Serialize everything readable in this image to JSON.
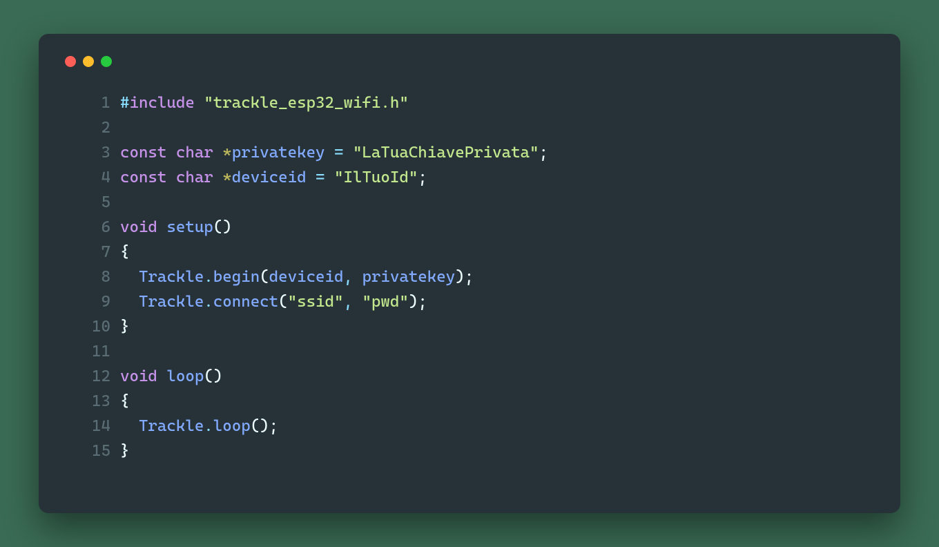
{
  "window": {
    "dots": [
      "red",
      "yellow",
      "green"
    ]
  },
  "code": {
    "line_numbers": [
      "1",
      "2",
      "3",
      "4",
      "5",
      "6",
      "7",
      "8",
      "9",
      "10",
      "11",
      "12",
      "13",
      "14",
      "15"
    ],
    "lines": [
      {
        "tokens": [
          {
            "cls": "t-operator",
            "text": "#"
          },
          {
            "cls": "t-builtin",
            "text": "include"
          },
          {
            "cls": "t-ident",
            "text": " "
          },
          {
            "cls": "t-string",
            "text": "\"trackle_esp32_wifi.h\""
          }
        ]
      },
      {
        "tokens": []
      },
      {
        "tokens": [
          {
            "cls": "t-keyword",
            "text": "const"
          },
          {
            "cls": "t-ident",
            "text": " "
          },
          {
            "cls": "t-keyword",
            "text": "char"
          },
          {
            "cls": "t-ident",
            "text": " "
          },
          {
            "cls": "t-star",
            "text": "*"
          },
          {
            "cls": "t-var",
            "text": "privatekey"
          },
          {
            "cls": "t-ident",
            "text": " "
          },
          {
            "cls": "t-operator",
            "text": "="
          },
          {
            "cls": "t-ident",
            "text": " "
          },
          {
            "cls": "t-string",
            "text": "\"LaTuaChiavePrivata\""
          },
          {
            "cls": "t-semi",
            "text": ";"
          }
        ]
      },
      {
        "tokens": [
          {
            "cls": "t-keyword",
            "text": "const"
          },
          {
            "cls": "t-ident",
            "text": " "
          },
          {
            "cls": "t-keyword",
            "text": "char"
          },
          {
            "cls": "t-ident",
            "text": " "
          },
          {
            "cls": "t-star",
            "text": "*"
          },
          {
            "cls": "t-var",
            "text": "deviceid"
          },
          {
            "cls": "t-ident",
            "text": " "
          },
          {
            "cls": "t-operator",
            "text": "="
          },
          {
            "cls": "t-ident",
            "text": " "
          },
          {
            "cls": "t-string",
            "text": "\"IlTuoId\""
          },
          {
            "cls": "t-semi",
            "text": ";"
          }
        ]
      },
      {
        "tokens": []
      },
      {
        "tokens": [
          {
            "cls": "t-keyword",
            "text": "void"
          },
          {
            "cls": "t-ident",
            "text": " "
          },
          {
            "cls": "t-func",
            "text": "setup"
          },
          {
            "cls": "t-paren",
            "text": "()"
          }
        ]
      },
      {
        "tokens": [
          {
            "cls": "t-brace",
            "text": "{"
          }
        ]
      },
      {
        "tokens": [
          {
            "cls": "t-ident",
            "text": "  "
          },
          {
            "cls": "t-obj",
            "text": "Trackle"
          },
          {
            "cls": "t-dot",
            "text": "."
          },
          {
            "cls": "t-func",
            "text": "begin"
          },
          {
            "cls": "t-paren",
            "text": "("
          },
          {
            "cls": "t-var",
            "text": "deviceid"
          },
          {
            "cls": "t-comma",
            "text": ","
          },
          {
            "cls": "t-ident",
            "text": " "
          },
          {
            "cls": "t-var",
            "text": "privatekey"
          },
          {
            "cls": "t-paren",
            "text": ")"
          },
          {
            "cls": "t-semi",
            "text": ";"
          }
        ]
      },
      {
        "tokens": [
          {
            "cls": "t-ident",
            "text": "  "
          },
          {
            "cls": "t-obj",
            "text": "Trackle"
          },
          {
            "cls": "t-dot",
            "text": "."
          },
          {
            "cls": "t-func",
            "text": "connect"
          },
          {
            "cls": "t-paren",
            "text": "("
          },
          {
            "cls": "t-string",
            "text": "\"ssid\""
          },
          {
            "cls": "t-comma",
            "text": ","
          },
          {
            "cls": "t-ident",
            "text": " "
          },
          {
            "cls": "t-string",
            "text": "\"pwd\""
          },
          {
            "cls": "t-paren",
            "text": ")"
          },
          {
            "cls": "t-semi",
            "text": ";"
          }
        ]
      },
      {
        "tokens": [
          {
            "cls": "t-brace",
            "text": "}"
          }
        ]
      },
      {
        "tokens": []
      },
      {
        "tokens": [
          {
            "cls": "t-keyword",
            "text": "void"
          },
          {
            "cls": "t-ident",
            "text": " "
          },
          {
            "cls": "t-func",
            "text": "loop"
          },
          {
            "cls": "t-paren",
            "text": "()"
          }
        ]
      },
      {
        "tokens": [
          {
            "cls": "t-brace",
            "text": "{"
          }
        ]
      },
      {
        "tokens": [
          {
            "cls": "t-ident",
            "text": "  "
          },
          {
            "cls": "t-obj",
            "text": "Trackle"
          },
          {
            "cls": "t-dot",
            "text": "."
          },
          {
            "cls": "t-func",
            "text": "loop"
          },
          {
            "cls": "t-paren",
            "text": "()"
          },
          {
            "cls": "t-semi",
            "text": ";"
          }
        ]
      },
      {
        "tokens": [
          {
            "cls": "t-brace",
            "text": "}"
          }
        ]
      }
    ]
  }
}
